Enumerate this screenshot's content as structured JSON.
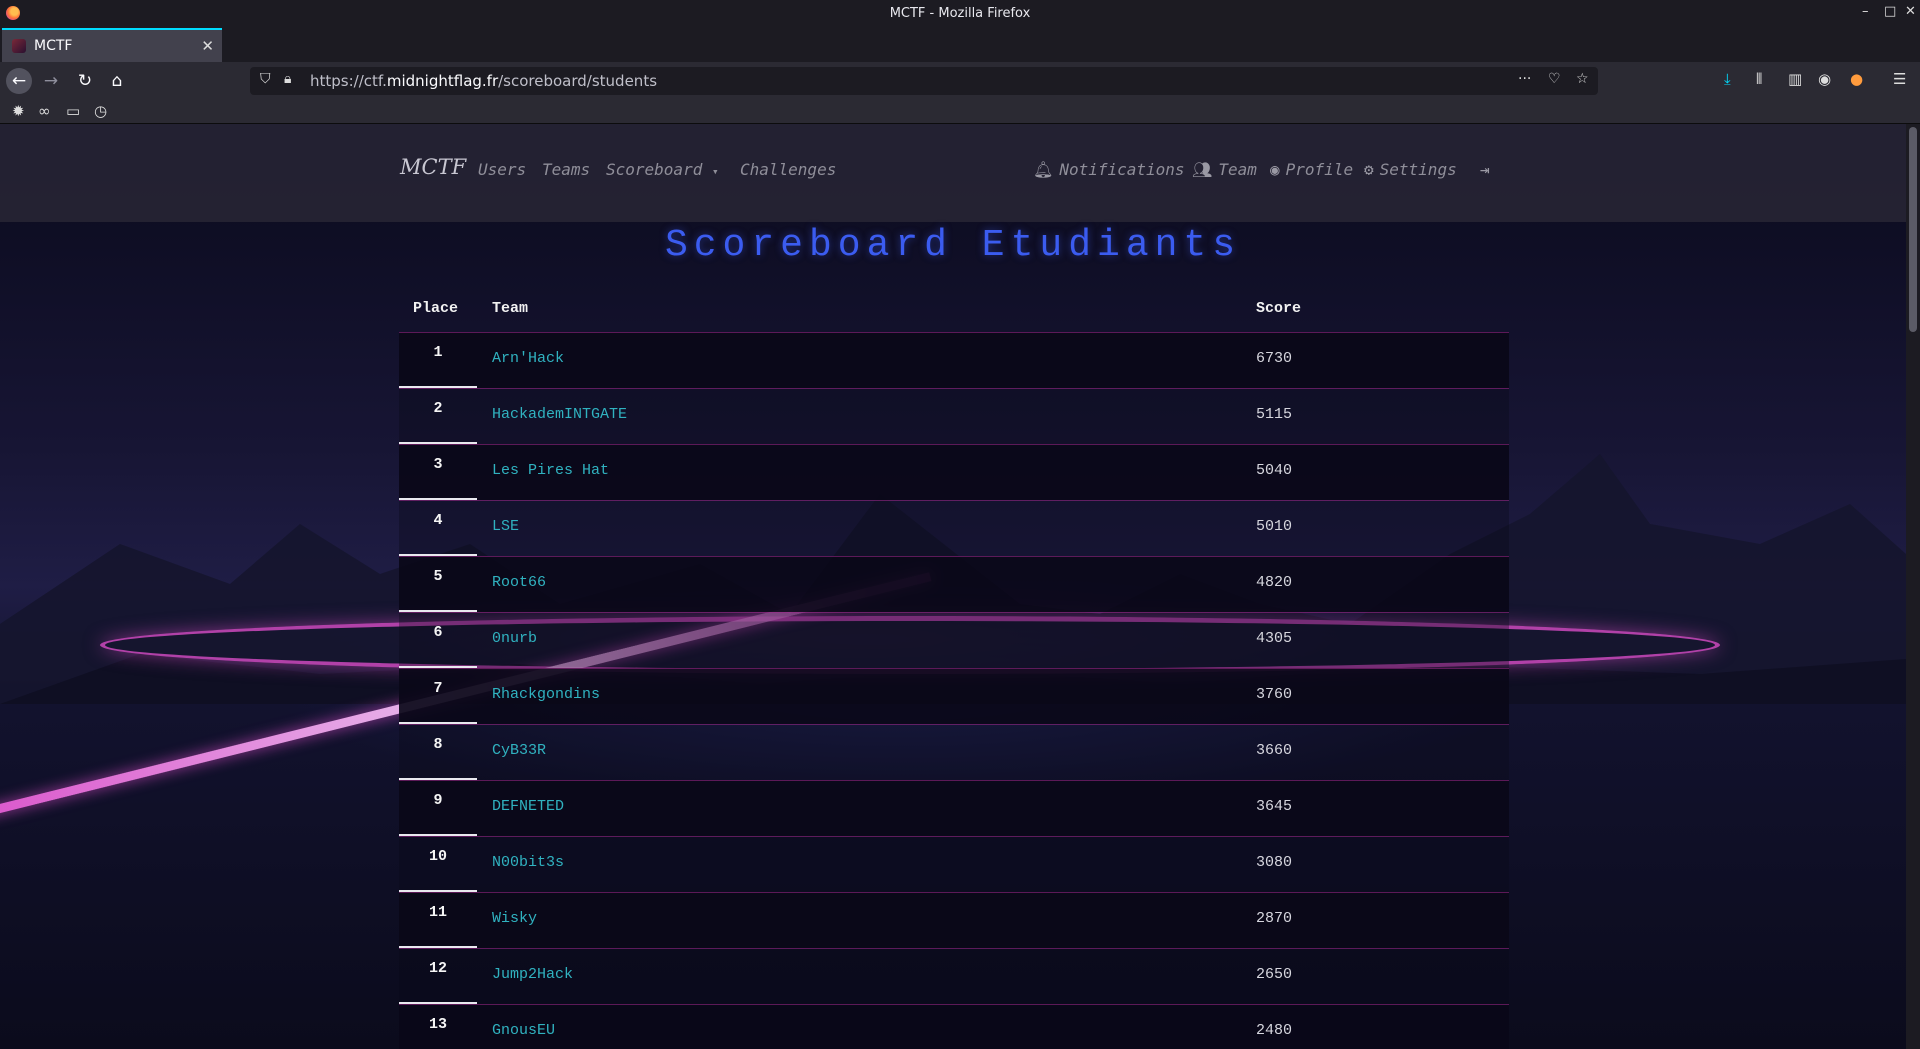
{
  "window": {
    "title": "MCTF - Mozilla Firefox"
  },
  "tab": {
    "label": "MCTF"
  },
  "browser": {
    "url_prefix": "https://ctf.",
    "url_host": "midnightflag.fr",
    "url_path": "/scoreboard/students"
  },
  "site": {
    "brand": "MCTF",
    "nav": {
      "users": "Users",
      "teams": "Teams",
      "scoreboard": "Scoreboard",
      "challenges": "Challenges",
      "notifications": "Notifications",
      "team": "Team",
      "profile": "Profile",
      "settings": "Settings"
    }
  },
  "scoreboard": {
    "title": "Scoreboard Etudiants",
    "headers": {
      "place": "Place",
      "team": "Team",
      "score": "Score"
    },
    "rows": [
      {
        "place": "1",
        "team": "Arn'Hack",
        "score": "6730"
      },
      {
        "place": "2",
        "team": "HackademINTGATE",
        "score": "5115"
      },
      {
        "place": "3",
        "team": "Les Pires Hat",
        "score": "5040"
      },
      {
        "place": "4",
        "team": "LSE",
        "score": "5010"
      },
      {
        "place": "5",
        "team": "Root66",
        "score": "4820"
      },
      {
        "place": "6",
        "team": "0nurb",
        "score": "4305"
      },
      {
        "place": "7",
        "team": "Rhackgondins",
        "score": "3760"
      },
      {
        "place": "8",
        "team": "CyB33R",
        "score": "3660"
      },
      {
        "place": "9",
        "team": "DEFNETED",
        "score": "3645"
      },
      {
        "place": "10",
        "team": "N00bit3s",
        "score": "3080"
      },
      {
        "place": "11",
        "team": "Wisky",
        "score": "2870"
      },
      {
        "place": "12",
        "team": "Jump2Hack",
        "score": "2650"
      },
      {
        "place": "13",
        "team": "GnousEU",
        "score": "2480"
      }
    ]
  },
  "colors": {
    "title_blue": "#3b5cf0",
    "team_link": "#30b2c0",
    "row_border": "#a0288c"
  }
}
